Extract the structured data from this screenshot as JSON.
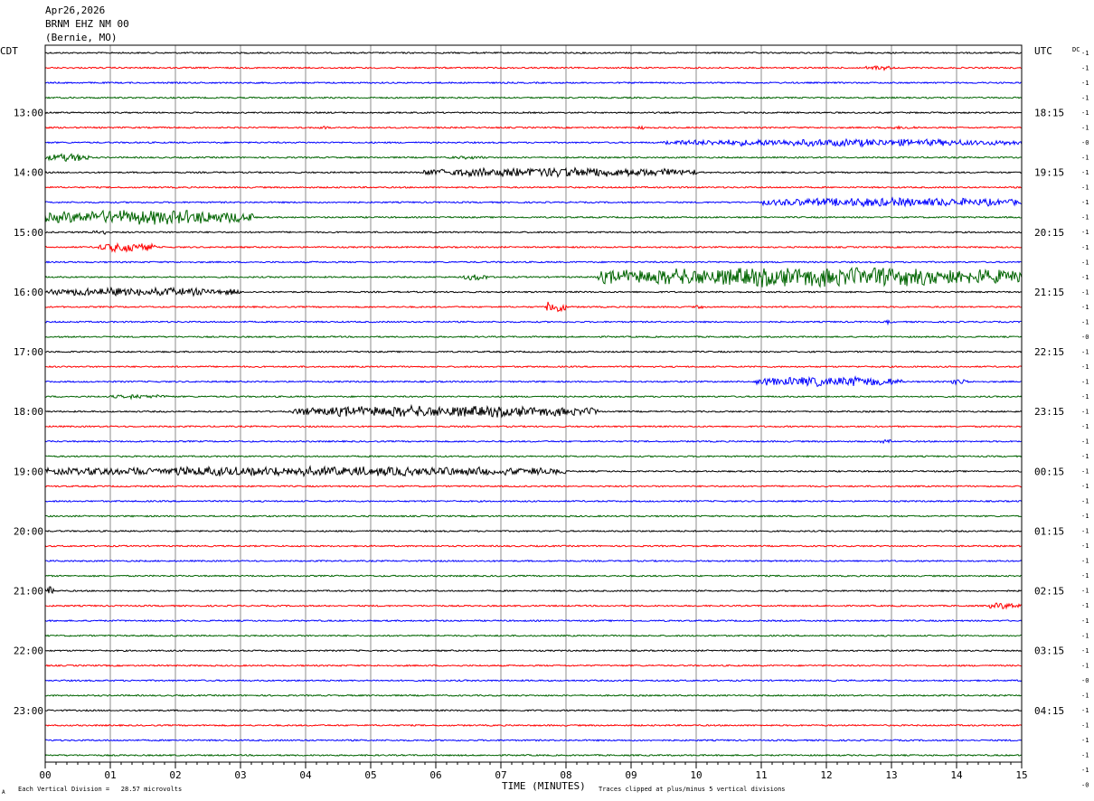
{
  "header": {
    "date": "Apr26,2026",
    "station": "BRNM EHZ NM 00",
    "location": "(Bernie, MO)"
  },
  "labels": {
    "left_tz": "CDT",
    "right_tz": "UTC",
    "dc": "DC",
    "x_axis_title": "TIME (MINUTES)",
    "scale_note": "Each Vertical Division =   28.57 microvolts",
    "clip_note": "Traces clipped at plus/minus 5 vertical divisions",
    "corner_mark": "A"
  },
  "colors": {
    "trace_cycle": [
      "#000000",
      "#ff0000",
      "#0000ff",
      "#006400"
    ],
    "grid": "#8c8c8c",
    "frame": "#000000"
  },
  "chart_data": {
    "type": "helicorder",
    "title": "BRNM EHZ NM 00",
    "xlabel": "TIME (MINUTES)",
    "xlim": [
      0,
      15
    ],
    "x_ticks": [
      "00",
      "01",
      "02",
      "03",
      "04",
      "05",
      "06",
      "07",
      "08",
      "09",
      "10",
      "11",
      "12",
      "13",
      "14",
      "15"
    ],
    "rows_per_hour": 4,
    "row_count": 48,
    "left_hour_labels": [
      {
        "row": 4,
        "label": "13:00"
      },
      {
        "row": 8,
        "label": "14:00"
      },
      {
        "row": 12,
        "label": "15:00"
      },
      {
        "row": 16,
        "label": "16:00"
      },
      {
        "row": 20,
        "label": "17:00"
      },
      {
        "row": 24,
        "label": "18:00"
      },
      {
        "row": 28,
        "label": "19:00"
      },
      {
        "row": 32,
        "label": "20:00"
      },
      {
        "row": 36,
        "label": "21:00"
      },
      {
        "row": 40,
        "label": "22:00"
      },
      {
        "row": 44,
        "label": "23:00"
      }
    ],
    "right_hour_labels": [
      {
        "row": 4,
        "label": "18:15"
      },
      {
        "row": 8,
        "label": "19:15"
      },
      {
        "row": 12,
        "label": "20:15"
      },
      {
        "row": 16,
        "label": "21:15"
      },
      {
        "row": 20,
        "label": "22:15"
      },
      {
        "row": 24,
        "label": "23:15"
      },
      {
        "row": 28,
        "label": "00:15"
      },
      {
        "row": 32,
        "label": "01:15"
      },
      {
        "row": 36,
        "label": "02:15"
      },
      {
        "row": 40,
        "label": "03:15"
      },
      {
        "row": 44,
        "label": "04:15"
      }
    ],
    "dc_offsets": [
      "-1",
      "-1",
      "-1",
      "-1",
      "-1",
      "-1",
      "-0",
      "-1",
      "-1",
      "-1",
      "-1",
      "-1",
      "-1",
      "-1",
      "-1",
      "-1",
      "-1",
      "-1",
      "-1",
      "-0",
      "-1",
      "-1",
      "-1",
      "-1",
      "-1",
      "-1",
      "-1",
      "-1",
      "-1",
      "-1",
      "-1",
      "-1",
      "-1",
      "-1",
      "-1",
      "-1",
      "-1",
      "-1",
      "-1",
      "-1",
      "-1",
      "-1",
      "-0",
      "-1",
      "-1",
      "-1",
      "-1",
      "-1",
      "-1",
      "-0"
    ],
    "scale_microvolts_per_division": 28.57,
    "clip_divisions": 5,
    "events": [
      {
        "row": 1,
        "start": 12.6,
        "end": 13.0,
        "amp": 3
      },
      {
        "row": 5,
        "start": 4.2,
        "end": 4.4,
        "amp": 2
      },
      {
        "row": 5,
        "start": 9.1,
        "end": 9.2,
        "amp": 3
      },
      {
        "row": 5,
        "start": 12.9,
        "end": 13.5,
        "amp": 2
      },
      {
        "row": 6,
        "start": 9.5,
        "end": 15.0,
        "amp": 4.5
      },
      {
        "row": 7,
        "start": 0.0,
        "end": 0.7,
        "amp": 5
      },
      {
        "row": 7,
        "start": 6.2,
        "end": 6.8,
        "amp": 2
      },
      {
        "row": 8,
        "start": 5.8,
        "end": 10.0,
        "amp": 6
      },
      {
        "row": 10,
        "start": 11.0,
        "end": 15.0,
        "amp": 5.5
      },
      {
        "row": 11,
        "start": 0.0,
        "end": 3.2,
        "amp": 9
      },
      {
        "row": 12,
        "start": 0.7,
        "end": 1.0,
        "amp": 4
      },
      {
        "row": 13,
        "start": 0.8,
        "end": 1.7,
        "amp": 6
      },
      {
        "row": 15,
        "start": 6.4,
        "end": 6.8,
        "amp": 4
      },
      {
        "row": 15,
        "start": 8.5,
        "end": 15.0,
        "amp": 12
      },
      {
        "row": 16,
        "start": 0.0,
        "end": 3.0,
        "amp": 5
      },
      {
        "row": 17,
        "start": 7.7,
        "end": 8.0,
        "amp": 8
      },
      {
        "row": 17,
        "start": 10.0,
        "end": 10.1,
        "amp": 3
      },
      {
        "row": 18,
        "start": 12.9,
        "end": 13.0,
        "amp": 3
      },
      {
        "row": 22,
        "start": 10.9,
        "end": 13.2,
        "amp": 6
      },
      {
        "row": 22,
        "start": 13.9,
        "end": 14.2,
        "amp": 4
      },
      {
        "row": 23,
        "start": 1.0,
        "end": 2.0,
        "amp": 2.5
      },
      {
        "row": 24,
        "start": 3.8,
        "end": 8.5,
        "amp": 7
      },
      {
        "row": 28,
        "start": 0.0,
        "end": 8.0,
        "amp": 6
      },
      {
        "row": 26,
        "start": 12.8,
        "end": 13.0,
        "amp": 2.5
      },
      {
        "row": 36,
        "start": 0.0,
        "end": 0.15,
        "amp": 5
      },
      {
        "row": 37,
        "start": 14.5,
        "end": 15.0,
        "amp": 4
      }
    ]
  }
}
